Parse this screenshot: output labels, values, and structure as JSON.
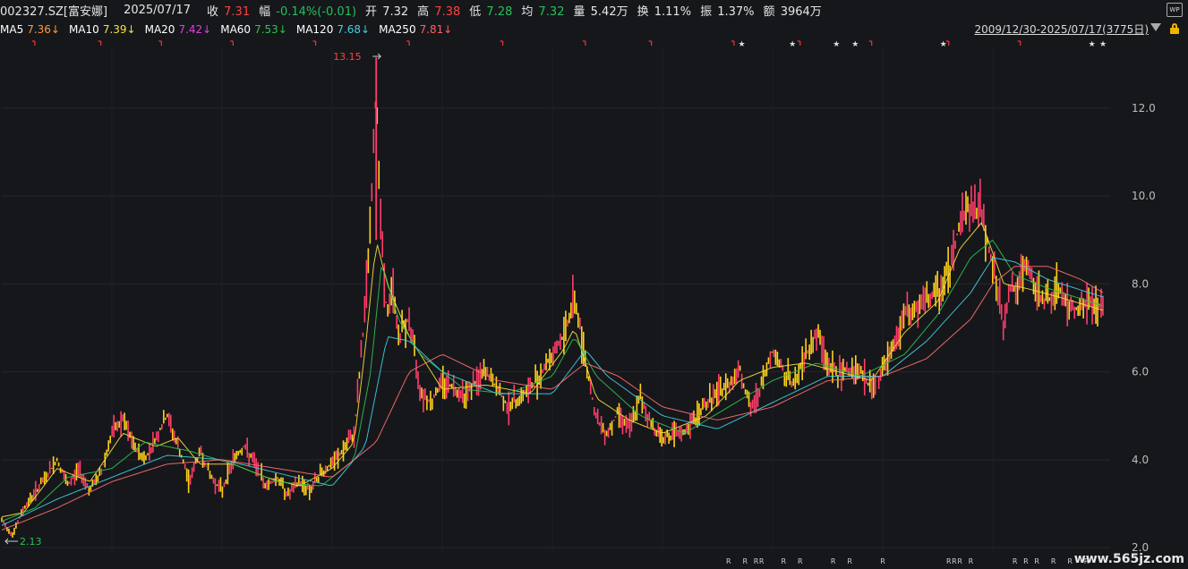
{
  "quote": {
    "code": "002327.SZ[富安娜]",
    "date": "2025/07/17",
    "close_label": "收",
    "close": "7.31",
    "change_label": "幅",
    "change": "-0.14%(-0.01)",
    "open_label": "开",
    "open": "7.32",
    "high_label": "高",
    "high": "7.38",
    "low_label": "低",
    "low": "7.28",
    "avg_label": "均",
    "avg": "7.32",
    "volume_label": "量",
    "volume": "5.42万",
    "turnover_label": "换",
    "turnover": "1.11%",
    "amplitude_label": "振",
    "amplitude": "1.37%",
    "amount_label": "额",
    "amount": "3964万"
  },
  "ma_legend": [
    {
      "name": "MA5",
      "value": "7.36↓",
      "color": "#ffffff",
      "value_color": "#ff9a3c"
    },
    {
      "name": "MA10",
      "value": "7.39↓",
      "color": "#ffffff",
      "value_color": "#f5e13a"
    },
    {
      "name": "MA20",
      "value": "7.42↓",
      "color": "#ffffff",
      "value_color": "#e040e0"
    },
    {
      "name": "MA60",
      "value": "7.53↓",
      "color": "#ffffff",
      "value_color": "#30c050"
    },
    {
      "name": "MA120",
      "value": "7.68↓",
      "color": "#ffffff",
      "value_color": "#40d0e0"
    },
    {
      "name": "MA250",
      "value": "7.81↓",
      "color": "#ffffff",
      "value_color": "#ff6060"
    }
  ],
  "date_range": "2009/12/30-2025/07/17(3775日)",
  "icons": {
    "top_right": "wp-icon",
    "range": "dropdown-arrow-icon",
    "lock": "lock-icon"
  },
  "wp_text": "WP",
  "watermark": "www.565jz.com",
  "annotations": {
    "max_label": "13.15",
    "min_label": "2.13"
  },
  "chart_data": {
    "type": "line",
    "title": "",
    "y_axis": {
      "ticks": [
        "12.0",
        "10.0",
        "8.0",
        "6.0",
        "4.0",
        "2.0"
      ],
      "tick_values": [
        12,
        10,
        8,
        6,
        4,
        2
      ],
      "ylim": [
        1.9,
        13.4
      ],
      "position": "right"
    },
    "x_range": [
      0,
      1
    ],
    "series": [
      {
        "key": "price",
        "color": "#ffd000",
        "points": [
          [
            0,
            2.6
          ],
          [
            0.01,
            2.3
          ],
          [
            0.02,
            2.9
          ],
          [
            0.04,
            3.6
          ],
          [
            0.05,
            4.0
          ],
          [
            0.06,
            3.4
          ],
          [
            0.07,
            3.8
          ],
          [
            0.08,
            3.3
          ],
          [
            0.09,
            3.7
          ],
          [
            0.1,
            4.6
          ],
          [
            0.11,
            4.9
          ],
          [
            0.12,
            4.3
          ],
          [
            0.13,
            4.0
          ],
          [
            0.14,
            4.5
          ],
          [
            0.15,
            5.0
          ],
          [
            0.16,
            4.3
          ],
          [
            0.17,
            3.5
          ],
          [
            0.18,
            4.2
          ],
          [
            0.19,
            3.6
          ],
          [
            0.2,
            3.3
          ],
          [
            0.21,
            4.0
          ],
          [
            0.22,
            4.3
          ],
          [
            0.23,
            3.9
          ],
          [
            0.24,
            3.4
          ],
          [
            0.25,
            3.6
          ],
          [
            0.26,
            3.2
          ],
          [
            0.27,
            3.5
          ],
          [
            0.28,
            3.3
          ],
          [
            0.29,
            3.7
          ],
          [
            0.3,
            3.9
          ],
          [
            0.31,
            4.2
          ],
          [
            0.32,
            4.6
          ],
          [
            0.325,
            6.0
          ],
          [
            0.33,
            7.5
          ],
          [
            0.335,
            9.5
          ],
          [
            0.34,
            12.5
          ],
          [
            0.345,
            9.0
          ],
          [
            0.35,
            7.2
          ],
          [
            0.355,
            8.0
          ],
          [
            0.36,
            6.8
          ],
          [
            0.37,
            7.2
          ],
          [
            0.38,
            5.6
          ],
          [
            0.39,
            5.3
          ],
          [
            0.4,
            5.8
          ],
          [
            0.42,
            5.5
          ],
          [
            0.44,
            6.0
          ],
          [
            0.46,
            5.2
          ],
          [
            0.48,
            5.6
          ],
          [
            0.5,
            6.4
          ],
          [
            0.51,
            6.8
          ],
          [
            0.52,
            7.7
          ],
          [
            0.53,
            6.3
          ],
          [
            0.54,
            4.9
          ],
          [
            0.55,
            4.6
          ],
          [
            0.56,
            5.1
          ],
          [
            0.57,
            4.7
          ],
          [
            0.58,
            5.4
          ],
          [
            0.59,
            4.8
          ],
          [
            0.6,
            4.5
          ],
          [
            0.62,
            4.6
          ],
          [
            0.64,
            5.3
          ],
          [
            0.66,
            5.7
          ],
          [
            0.67,
            6.1
          ],
          [
            0.68,
            5.1
          ],
          [
            0.69,
            5.7
          ],
          [
            0.7,
            6.5
          ],
          [
            0.71,
            6.0
          ],
          [
            0.72,
            5.7
          ],
          [
            0.73,
            6.4
          ],
          [
            0.74,
            6.9
          ],
          [
            0.75,
            6.2
          ],
          [
            0.76,
            5.9
          ],
          [
            0.77,
            6.1
          ],
          [
            0.78,
            6.0
          ],
          [
            0.79,
            5.6
          ],
          [
            0.8,
            6.0
          ],
          [
            0.81,
            6.6
          ],
          [
            0.82,
            7.3
          ],
          [
            0.83,
            7.4
          ],
          [
            0.84,
            7.6
          ],
          [
            0.85,
            7.8
          ],
          [
            0.86,
            8.3
          ],
          [
            0.87,
            9.4
          ],
          [
            0.88,
            9.8
          ],
          [
            0.89,
            9.6
          ],
          [
            0.9,
            8.4
          ],
          [
            0.91,
            7.0
          ],
          [
            0.915,
            8.0
          ],
          [
            0.92,
            7.8
          ],
          [
            0.93,
            8.4
          ],
          [
            0.94,
            7.8
          ],
          [
            0.95,
            7.6
          ],
          [
            0.96,
            7.9
          ],
          [
            0.97,
            7.4
          ],
          [
            0.98,
            7.5
          ],
          [
            0.99,
            7.6
          ],
          [
            1.0,
            7.4
          ]
        ]
      },
      {
        "key": "ma_fast",
        "color": "#f5e13a",
        "points": [
          [
            0,
            2.7
          ],
          [
            0.02,
            2.8
          ],
          [
            0.05,
            3.8
          ],
          [
            0.08,
            3.5
          ],
          [
            0.11,
            4.6
          ],
          [
            0.14,
            4.3
          ],
          [
            0.16,
            4.5
          ],
          [
            0.18,
            3.9
          ],
          [
            0.21,
            3.9
          ],
          [
            0.24,
            3.6
          ],
          [
            0.27,
            3.4
          ],
          [
            0.3,
            3.8
          ],
          [
            0.32,
            4.4
          ],
          [
            0.33,
            6.5
          ],
          [
            0.34,
            9.0
          ],
          [
            0.35,
            8.0
          ],
          [
            0.37,
            6.8
          ],
          [
            0.4,
            5.6
          ],
          [
            0.44,
            5.7
          ],
          [
            0.48,
            5.5
          ],
          [
            0.51,
            6.5
          ],
          [
            0.52,
            7.0
          ],
          [
            0.54,
            5.4
          ],
          [
            0.57,
            4.9
          ],
          [
            0.6,
            4.6
          ],
          [
            0.64,
            5.0
          ],
          [
            0.67,
            5.8
          ],
          [
            0.7,
            6.1
          ],
          [
            0.73,
            6.2
          ],
          [
            0.76,
            6.0
          ],
          [
            0.79,
            5.8
          ],
          [
            0.82,
            6.9
          ],
          [
            0.85,
            7.6
          ],
          [
            0.87,
            8.8
          ],
          [
            0.89,
            9.4
          ],
          [
            0.91,
            8.0
          ],
          [
            0.93,
            7.9
          ],
          [
            0.96,
            7.7
          ],
          [
            1.0,
            7.4
          ]
        ]
      },
      {
        "key": "ma_mid",
        "color": "#30c050",
        "points": [
          [
            0,
            2.6
          ],
          [
            0.03,
            2.9
          ],
          [
            0.06,
            3.6
          ],
          [
            0.1,
            3.8
          ],
          [
            0.13,
            4.4
          ],
          [
            0.17,
            4.2
          ],
          [
            0.21,
            3.9
          ],
          [
            0.25,
            3.5
          ],
          [
            0.29,
            3.4
          ],
          [
            0.32,
            4.0
          ],
          [
            0.335,
            6.0
          ],
          [
            0.345,
            8.5
          ],
          [
            0.36,
            7.2
          ],
          [
            0.38,
            6.4
          ],
          [
            0.42,
            5.6
          ],
          [
            0.46,
            5.5
          ],
          [
            0.5,
            5.9
          ],
          [
            0.52,
            6.8
          ],
          [
            0.54,
            5.9
          ],
          [
            0.58,
            5.0
          ],
          [
            0.62,
            4.6
          ],
          [
            0.66,
            5.2
          ],
          [
            0.7,
            5.8
          ],
          [
            0.74,
            6.2
          ],
          [
            0.78,
            5.9
          ],
          [
            0.82,
            6.4
          ],
          [
            0.85,
            7.3
          ],
          [
            0.88,
            8.6
          ],
          [
            0.9,
            9.0
          ],
          [
            0.92,
            8.2
          ],
          [
            0.95,
            7.9
          ],
          [
            1.0,
            7.5
          ]
        ]
      },
      {
        "key": "ma_slow",
        "color": "#40d0e0",
        "points": [
          [
            0,
            2.5
          ],
          [
            0.05,
            3.1
          ],
          [
            0.1,
            3.6
          ],
          [
            0.15,
            4.1
          ],
          [
            0.2,
            4.0
          ],
          [
            0.25,
            3.7
          ],
          [
            0.3,
            3.4
          ],
          [
            0.33,
            4.3
          ],
          [
            0.35,
            6.8
          ],
          [
            0.37,
            6.7
          ],
          [
            0.4,
            6.0
          ],
          [
            0.45,
            5.5
          ],
          [
            0.5,
            5.5
          ],
          [
            0.53,
            6.5
          ],
          [
            0.55,
            5.9
          ],
          [
            0.6,
            5.0
          ],
          [
            0.65,
            4.7
          ],
          [
            0.7,
            5.3
          ],
          [
            0.75,
            5.9
          ],
          [
            0.8,
            5.9
          ],
          [
            0.84,
            6.7
          ],
          [
            0.88,
            7.8
          ],
          [
            0.9,
            8.6
          ],
          [
            0.92,
            8.5
          ],
          [
            0.95,
            8.1
          ],
          [
            1.0,
            7.7
          ]
        ]
      },
      {
        "key": "ma_long",
        "color": "#ff7070",
        "points": [
          [
            0,
            2.4
          ],
          [
            0.05,
            2.9
          ],
          [
            0.1,
            3.5
          ],
          [
            0.15,
            3.9
          ],
          [
            0.2,
            4.0
          ],
          [
            0.25,
            3.8
          ],
          [
            0.3,
            3.6
          ],
          [
            0.34,
            4.4
          ],
          [
            0.37,
            6.0
          ],
          [
            0.4,
            6.4
          ],
          [
            0.45,
            5.8
          ],
          [
            0.5,
            5.6
          ],
          [
            0.53,
            6.2
          ],
          [
            0.56,
            5.9
          ],
          [
            0.6,
            5.2
          ],
          [
            0.65,
            4.9
          ],
          [
            0.7,
            5.2
          ],
          [
            0.75,
            5.8
          ],
          [
            0.8,
            5.9
          ],
          [
            0.84,
            6.3
          ],
          [
            0.88,
            7.2
          ],
          [
            0.9,
            8.0
          ],
          [
            0.92,
            8.4
          ],
          [
            0.95,
            8.4
          ],
          [
            0.98,
            8.1
          ],
          [
            1.0,
            7.8
          ]
        ]
      }
    ]
  }
}
